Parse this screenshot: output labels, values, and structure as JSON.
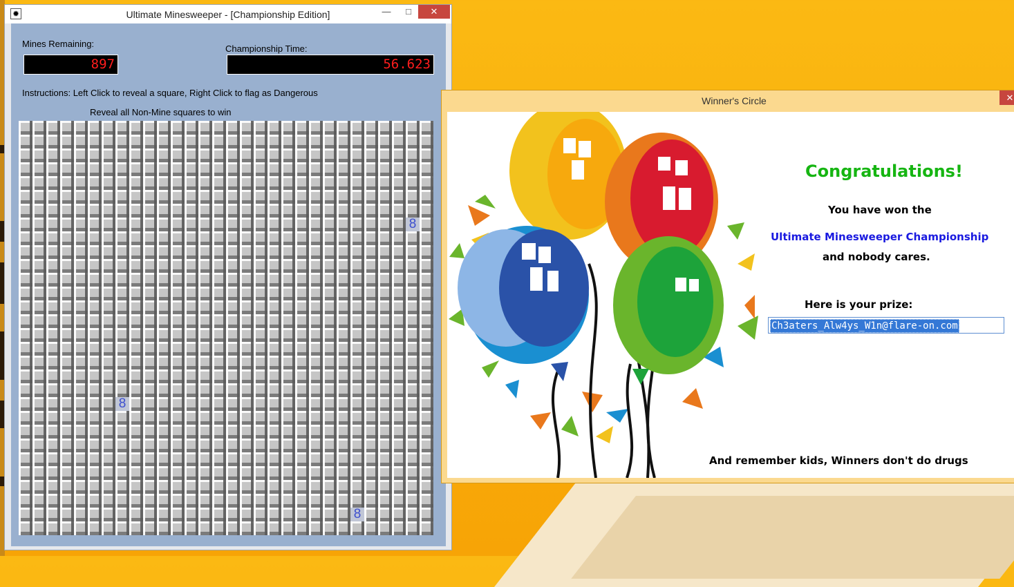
{
  "minesweeper": {
    "title": "Ultimate Minesweeper - [Championship Edition]",
    "window_controls": {
      "minimize": "—",
      "maximize": "□",
      "close": "✕"
    },
    "app_icon": "mine-icon",
    "mines_label": "Mines Remaining:",
    "mines_value": "897",
    "time_label": "Championship Time:",
    "time_value": "56.623",
    "instructions": "Instructions: Left Click to reveal a square, Right Click to flag as Dangerous",
    "goal": "Reveal all Non-Mine squares to win",
    "board": {
      "rows": 30,
      "cols": 30
    },
    "revealed_cells": [
      {
        "row": 7,
        "col": 28,
        "value": "8"
      },
      {
        "row": 20,
        "col": 7,
        "value": "8"
      },
      {
        "row": 28,
        "col": 24,
        "value": "8"
      }
    ]
  },
  "winners": {
    "title": "Winner's Circle",
    "close": "✕",
    "congrats": "Congratulations!",
    "won_line": "You have won the",
    "championship": "Ultimate Minesweeper Championship",
    "nobody": "and nobody cares.",
    "prize_label": "Here is your prize:",
    "prize_value": "Ch3aters_Alw4ys_W1n@flare-on.com",
    "footer": "And remember kids, Winners don't do drugs"
  }
}
